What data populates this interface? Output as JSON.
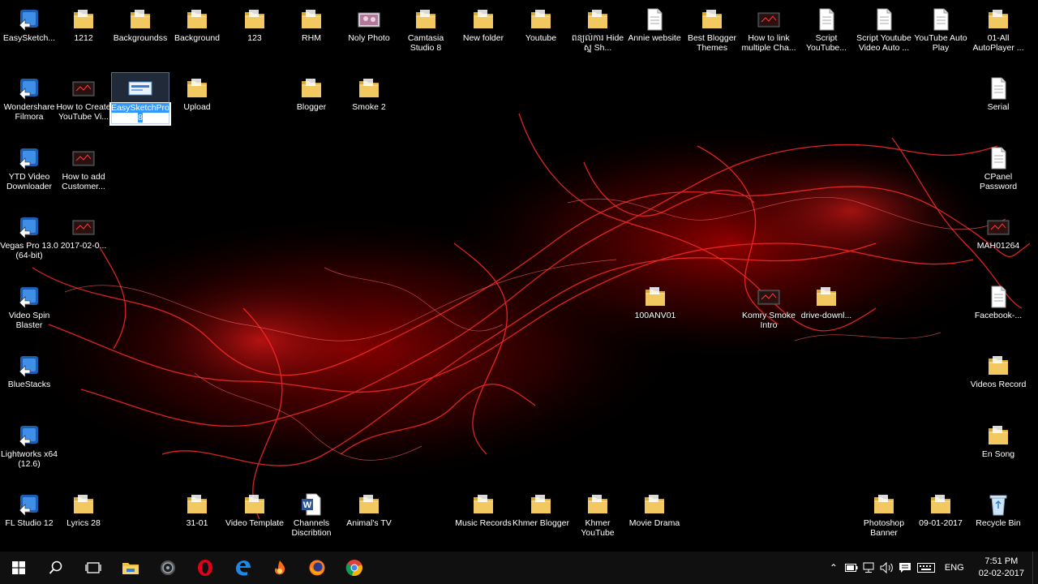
{
  "desktop": {
    "icons": [
      {
        "label": "EasySketch...",
        "type": "app"
      },
      {
        "label": "1212",
        "type": "folder"
      },
      {
        "label": "Backgroundss",
        "type": "folder"
      },
      {
        "label": "Background",
        "type": "folder"
      },
      {
        "label": "123",
        "type": "folder"
      },
      {
        "label": "RHM",
        "type": "folder"
      },
      {
        "label": "Noly Photo",
        "type": "image"
      },
      {
        "label": "Camtasia Studio 8",
        "type": "folder"
      },
      {
        "label": "New folder",
        "type": "folder"
      },
      {
        "label": "Youtube",
        "type": "folder"
      },
      {
        "label": "ពន្យល់ការ Hide ស្ន Sh...",
        "type": "folder"
      },
      {
        "label": "Annie website",
        "type": "doc"
      },
      {
        "label": "Best Blogger Themes",
        "type": "folder"
      },
      {
        "label": "How to link multiple Cha...",
        "type": "video"
      },
      {
        "label": "Script YouTube...",
        "type": "doc"
      },
      {
        "label": "Script Youtube Video Auto ...",
        "type": "doc"
      },
      {
        "label": "YouTube Auto Play",
        "type": "doc"
      },
      {
        "label": "01-All AutoPlayer ...",
        "type": "folder"
      },
      {
        "label": "Wondershare Filmora",
        "type": "app"
      },
      {
        "label": "How to Create YouTube Vi...",
        "type": "video"
      },
      {
        "label": "Upload",
        "type": "folder"
      },
      {
        "label": "Blogger",
        "type": "folder"
      },
      {
        "label": "Smoke 2",
        "type": "folder"
      },
      {
        "label": "Serial",
        "type": "doc"
      },
      {
        "label": "YTD Video Downloader",
        "type": "app"
      },
      {
        "label": "How to  add Customer...",
        "type": "video"
      },
      {
        "label": "CPanel Password",
        "type": "doc"
      },
      {
        "label": "Vegas Pro 13.0 (64-bit)",
        "type": "app"
      },
      {
        "label": "2017-02-0...",
        "type": "video"
      },
      {
        "label": "MAH01264",
        "type": "video"
      },
      {
        "label": "Video Spin Blaster",
        "type": "app"
      },
      {
        "label": "100ANV01",
        "type": "folder"
      },
      {
        "label": "Komry Smoke Intro",
        "type": "video"
      },
      {
        "label": "drive-downl...",
        "type": "folder"
      },
      {
        "label": "Facebook-...",
        "type": "doc"
      },
      {
        "label": "BlueStacks",
        "type": "app"
      },
      {
        "label": "Videos Record",
        "type": "folder"
      },
      {
        "label": "Lightworks x64 (12.6)",
        "type": "app"
      },
      {
        "label": "En Song",
        "type": "folder"
      },
      {
        "label": "FL Studio 12",
        "type": "app"
      },
      {
        "label": "Lyrics 28",
        "type": "folder"
      },
      {
        "label": "31-01",
        "type": "folder"
      },
      {
        "label": "Video Template",
        "type": "folder"
      },
      {
        "label": "Channels Discribtion",
        "type": "word"
      },
      {
        "label": "Animal's TV",
        "type": "folder"
      },
      {
        "label": "Music Records",
        "type": "folder"
      },
      {
        "label": "Khmer Blogger",
        "type": "folder"
      },
      {
        "label": "Khmer YouTube",
        "type": "folder"
      },
      {
        "label": "Movie Drama",
        "type": "folder"
      },
      {
        "label": "Photoshop Banner",
        "type": "folder"
      },
      {
        "label": "09-01-2017",
        "type": "folder"
      },
      {
        "label": "Recycle Bin",
        "type": "recycle"
      }
    ],
    "selected": {
      "label": "EasySketchPro",
      "rename_suffix": "8"
    }
  },
  "taskbar": {
    "pinned": [
      "start-icon",
      "search-icon",
      "task-view-icon",
      "file-explorer-icon",
      "media-icon",
      "opera-icon",
      "edge-icon",
      "app-icon",
      "firefox-icon",
      "chrome-icon"
    ],
    "language": "ENG",
    "time": "7:51 PM",
    "date": "02-02-2017"
  },
  "colors": {
    "wallpaper": "#000000",
    "accent": "#e01010",
    "selection": "#3399ff",
    "taskbar": "#101010"
  }
}
